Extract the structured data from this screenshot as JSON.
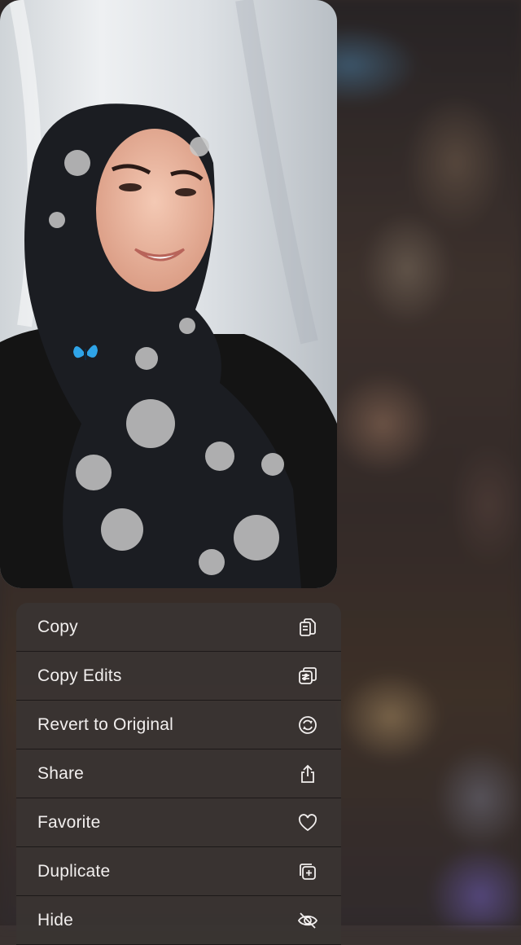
{
  "menu": {
    "items": [
      {
        "label": "Copy",
        "icon": "copy-icon"
      },
      {
        "label": "Copy Edits",
        "icon": "copy-edits-icon"
      },
      {
        "label": "Revert to Original",
        "icon": "revert-icon"
      },
      {
        "label": "Share",
        "icon": "share-icon"
      },
      {
        "label": "Favorite",
        "icon": "heart-icon"
      },
      {
        "label": "Duplicate",
        "icon": "duplicate-icon"
      },
      {
        "label": "Hide",
        "icon": "eye-slash-icon"
      }
    ]
  },
  "colors": {
    "menu_background": "#3a3432",
    "menu_text": "#f2efee",
    "divider": "#141212"
  }
}
